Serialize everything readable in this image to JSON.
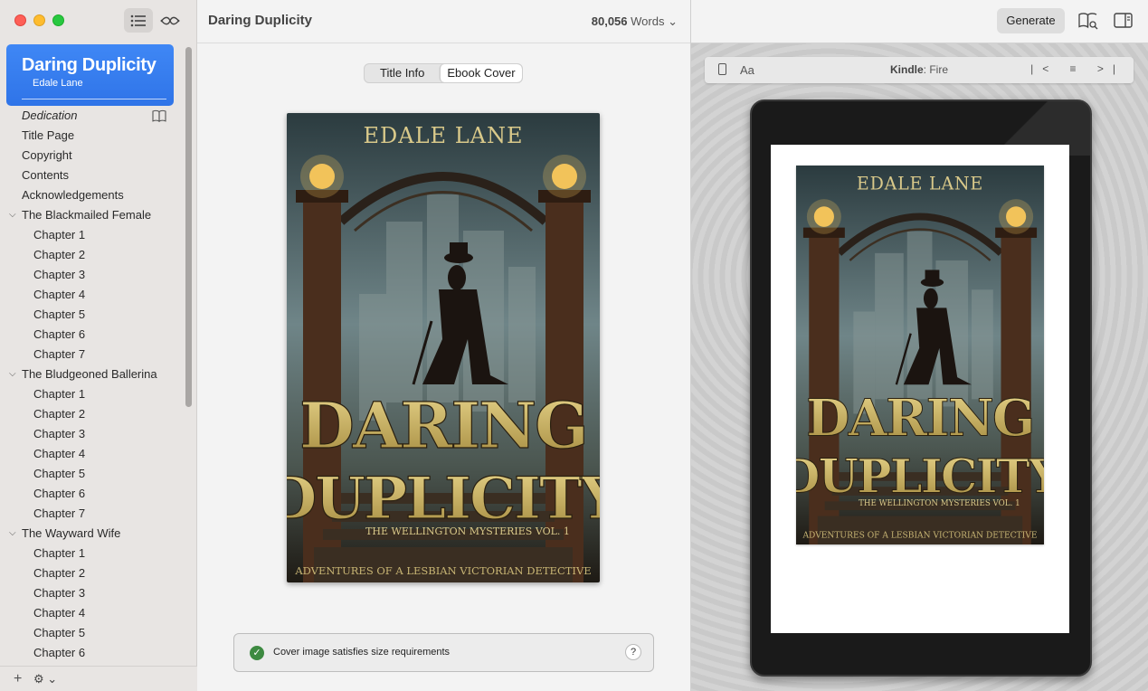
{
  "sidebar": {
    "book_title": "Daring Duplicity",
    "book_author": "Edale Lane",
    "front_matter": [
      {
        "label": "Dedication",
        "italic": true
      },
      {
        "label": "Title Page"
      },
      {
        "label": "Copyright"
      },
      {
        "label": "Contents"
      },
      {
        "label": "Acknowledgements"
      }
    ],
    "parts": [
      {
        "title": "The Blackmailed Female",
        "chapters": [
          "Chapter 1",
          "Chapter 2",
          "Chapter 3",
          "Chapter 4",
          "Chapter 5",
          "Chapter 6",
          "Chapter 7"
        ]
      },
      {
        "title": "The Bludgeoned Ballerina",
        "chapters": [
          "Chapter 1",
          "Chapter 2",
          "Chapter 3",
          "Chapter 4",
          "Chapter 5",
          "Chapter 6",
          "Chapter 7"
        ]
      },
      {
        "title": "The Wayward Wife",
        "chapters": [
          "Chapter 1",
          "Chapter 2",
          "Chapter 3",
          "Chapter 4",
          "Chapter 5",
          "Chapter 6"
        ]
      }
    ],
    "add_icon": "plus-icon",
    "settings_icon": "gear-icon"
  },
  "editor": {
    "doc_title": "Daring Duplicity",
    "word_count_number": "80,056",
    "word_count_unit": "Words",
    "tabs": {
      "title_info": "Title Info",
      "ebook_cover": "Ebook Cover"
    },
    "status_message": "Cover image satisfies size requirements",
    "help_label": "?"
  },
  "cover": {
    "author": "EDALE LANE",
    "title_line1": "DARING",
    "title_line2": "DUPLICITY",
    "series": "THE WELLINGTON MYSTERIES VOL. 1",
    "tagline": "ADVENTURES OF A LESBIAN VICTORIAN DETECTIVE"
  },
  "preview": {
    "generate_label": "Generate",
    "device_brand": "Kindle",
    "device_model": ": Fire",
    "font_label": "Aa",
    "nav_icons": "|< ≡ >|"
  },
  "colors": {
    "accent": "#3b82f6",
    "status_ok": "#3d8a41"
  }
}
